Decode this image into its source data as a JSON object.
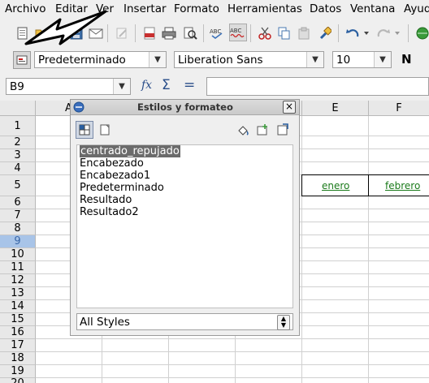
{
  "menu": {
    "items": [
      "Archivo",
      "Editar",
      "Ver",
      "Insertar",
      "Formato",
      "Herramientas",
      "Datos",
      "Ventana",
      "Ayuda"
    ]
  },
  "toolbar2": {
    "style_value": "Predeterminado",
    "font_value": "Liberation Sans",
    "size_value": "10",
    "bold_label": "N"
  },
  "formula_bar": {
    "name_box_value": "B9",
    "function_wizard_label": "fx",
    "sum_label": "Σ",
    "equals_label": "=",
    "input_value": ""
  },
  "sheet": {
    "columns": [
      "A",
      "E",
      "F"
    ],
    "rows": [
      "1",
      "2",
      "3",
      "4",
      "5",
      "6",
      "7",
      "8",
      "9",
      "10",
      "11",
      "12",
      "13",
      "14",
      "15",
      "16",
      "17",
      "18",
      "19",
      "20"
    ],
    "selected_row": "9",
    "cells": {
      "E5": "enero",
      "F5": "febrero"
    },
    "cell_text_color": "#1a7a1a"
  },
  "styles_dialog": {
    "title": "Estilos y formateo",
    "close_label": "×",
    "list": [
      "centrado_repujado",
      "Encabezado",
      "Encabezado1",
      "Predeterminado",
      "Resultado",
      "Resultado2"
    ],
    "selected_index": 0,
    "filter_value": "All Styles"
  }
}
